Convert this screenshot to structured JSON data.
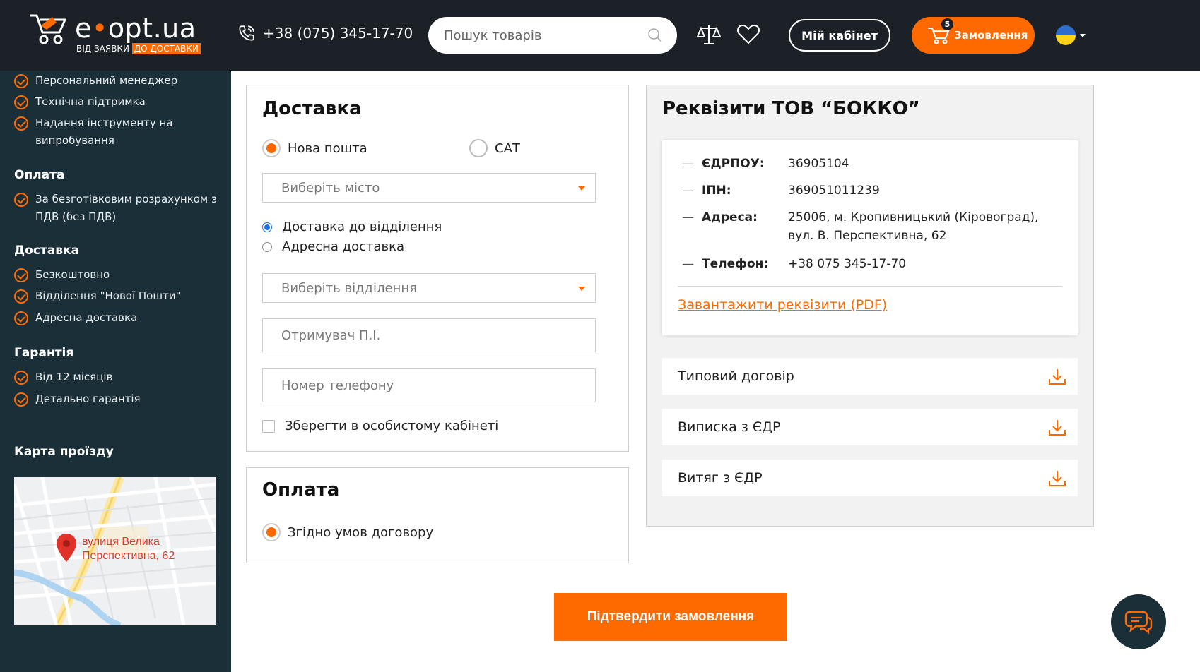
{
  "header": {
    "logo_text_a": "e",
    "logo_text_b": "opt.ua",
    "logo_sub_a": "ВІД ЗАЯВКИ",
    "logo_sub_b": "ДО ДОСТАВКИ",
    "phone": "+38 (075) 345-17-70",
    "search_placeholder": "Пошук товарів",
    "cabinet_label": "Мій кабінет",
    "orders_label": "Замовлення",
    "orders_count": "5",
    "icons": [
      "phone-icon",
      "search-icon",
      "compare-icon",
      "heart-icon",
      "cart-icon",
      "flag-ua-icon"
    ]
  },
  "sidebar": {
    "top_items": [
      "Персональний менеджер",
      "Технічна підтримка",
      "Надання інструменту на випробування"
    ],
    "payment_title": "Оплата",
    "payment_items": [
      "За безготівковим розрахунком з ПДВ (без ПДВ)"
    ],
    "delivery_title": "Доставка",
    "delivery_items": [
      "Безкоштовно",
      "Відділення \"Нової Пошти\"",
      "Адресна доставка"
    ],
    "warranty_title": "Гарантія",
    "warranty_items": [
      "Від 12 місяців",
      "Детально гарантія"
    ],
    "map_title": "Карта проїзду",
    "map_label_1": "вулиця Велика",
    "map_label_2": "Перспективна, 62"
  },
  "delivery": {
    "title": "Доставка",
    "carrier_1": "Нова пошта",
    "carrier_2": "САТ",
    "city_placeholder": "Виберіть місто",
    "option_1": "Доставка до відділення",
    "option_2": "Адресна доставка",
    "branch_placeholder": "Виберіть відділення",
    "recipient_placeholder": "Отримувач П.І.",
    "phone_placeholder": "Номер телефону",
    "save_label": "Зберегти в особистому кабінеті"
  },
  "payment": {
    "title": "Оплата",
    "option_1": "Згідно умов договору"
  },
  "requisites": {
    "title": "Реквізити ТОВ “БОККО”",
    "rows": [
      {
        "k": "ЄДРПОУ:",
        "v": "36905104"
      },
      {
        "k": "ІПН:",
        "v": "369051011239"
      },
      {
        "k": "Адреса:",
        "v": "25006, м. Кропивницький (Кіровоград), вул. В. Перспективна, 62"
      },
      {
        "k": "Телефон:",
        "v": "+38 075 345-17-70"
      }
    ],
    "download_link": "Завантажити реквізити (PDF)",
    "docs": [
      "Типовий договір",
      "Виписка з ЄДР",
      "Витяг з ЄДР"
    ]
  },
  "confirm_label": "Підтвердити замовлення",
  "colors": {
    "accent": "#ff6a00",
    "header_bg": "#1b2126",
    "sidebar_bg": "#1b2f38"
  }
}
